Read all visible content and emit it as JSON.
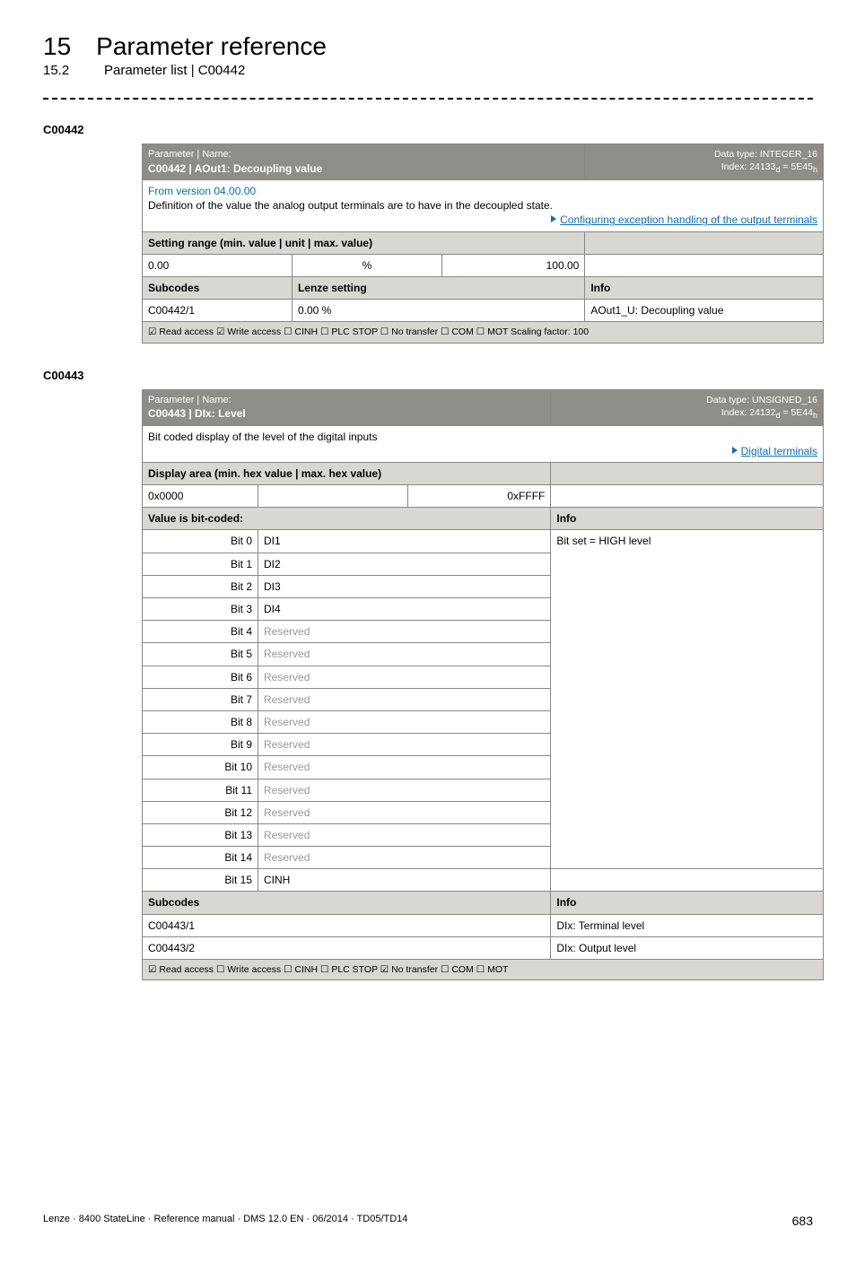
{
  "page": {
    "chapter_num": "15",
    "chapter_title": "Parameter reference",
    "sub_num": "15.2",
    "sub_title": "Parameter list | C00442"
  },
  "t1": {
    "code": "C00442",
    "pname": "Parameter | Name:",
    "name_line": "C00442 | AOut1: Decoupling value",
    "dtype": "Data type: INTEGER_16",
    "index": "Index: 24133",
    "index_d": "d",
    "index_eq": " = 5E45",
    "index_h": "h",
    "version": "From version 04.00.00",
    "desc": "Definition of the value the analog output terminals are to have in the decoupled state.",
    "link": "Configuring exception handling of the output terminals",
    "setting_label": "Setting range (min. value | unit | max. value)",
    "min": "0.00",
    "unit": "%",
    "max": "100.00",
    "subcodes_h": "Subcodes",
    "lenze_h": "Lenze setting",
    "info_h": "Info",
    "row_code": "C00442/1",
    "row_val": "0.00 %",
    "row_info": "AOut1_U: Decoupling value",
    "footer": "☑ Read access   ☑ Write access   ☐ CINH   ☐ PLC STOP   ☐ No transfer   ☐ COM   ☐ MOT      Scaling factor: 100"
  },
  "t2": {
    "code": "C00443",
    "pname": "Parameter | Name:",
    "name_line": "C00443 | DIx: Level",
    "dtype": "Data type: UNSIGNED_16",
    "index": "Index: 24132",
    "index_d": "d",
    "index_eq": " = 5E44",
    "index_h": "h",
    "desc": "Bit coded display of the level of the digital inputs",
    "link": "Digital terminals",
    "display_label": "Display area (min. hex value | max. hex value)",
    "min": "0x0000",
    "max": "0xFFFF",
    "bitcoded": "Value is bit-coded:",
    "info_h": "Info",
    "bit_info": "Bit set = HIGH level",
    "bits": [
      {
        "label": "Bit 0",
        "val": "DI1",
        "grey": false
      },
      {
        "label": "Bit 1",
        "val": "DI2",
        "grey": false
      },
      {
        "label": "Bit 2",
        "val": "DI3",
        "grey": false
      },
      {
        "label": "Bit 3",
        "val": "DI4",
        "grey": false
      },
      {
        "label": "Bit 4",
        "val": "Reserved",
        "grey": true
      },
      {
        "label": "Bit 5",
        "val": "Reserved",
        "grey": true
      },
      {
        "label": "Bit 6",
        "val": "Reserved",
        "grey": true
      },
      {
        "label": "Bit 7",
        "val": "Reserved",
        "grey": true
      },
      {
        "label": "Bit 8",
        "val": "Reserved",
        "grey": true
      },
      {
        "label": "Bit 9",
        "val": "Reserved",
        "grey": true
      },
      {
        "label": "Bit 10",
        "val": "Reserved",
        "grey": true
      },
      {
        "label": "Bit 11",
        "val": "Reserved",
        "grey": true
      },
      {
        "label": "Bit 12",
        "val": "Reserved",
        "grey": true
      },
      {
        "label": "Bit 13",
        "val": "Reserved",
        "grey": true
      },
      {
        "label": "Bit 14",
        "val": "Reserved",
        "grey": true
      },
      {
        "label": "Bit 15",
        "val": "CINH",
        "grey": false
      }
    ],
    "subcodes_h": "Subcodes",
    "info_h2": "Info",
    "sc1": "C00443/1",
    "sc1_info": "DIx: Terminal level",
    "sc2": "C00443/2",
    "sc2_info": "DIx: Output level",
    "footer": "☑ Read access   ☐ Write access   ☐ CINH   ☐ PLC STOP   ☑ No transfer   ☐ COM   ☐ MOT"
  },
  "footer": {
    "left": "Lenze · 8400 StateLine · Reference manual · DMS 12.0 EN · 06/2014 · TD05/TD14",
    "right": "683"
  }
}
